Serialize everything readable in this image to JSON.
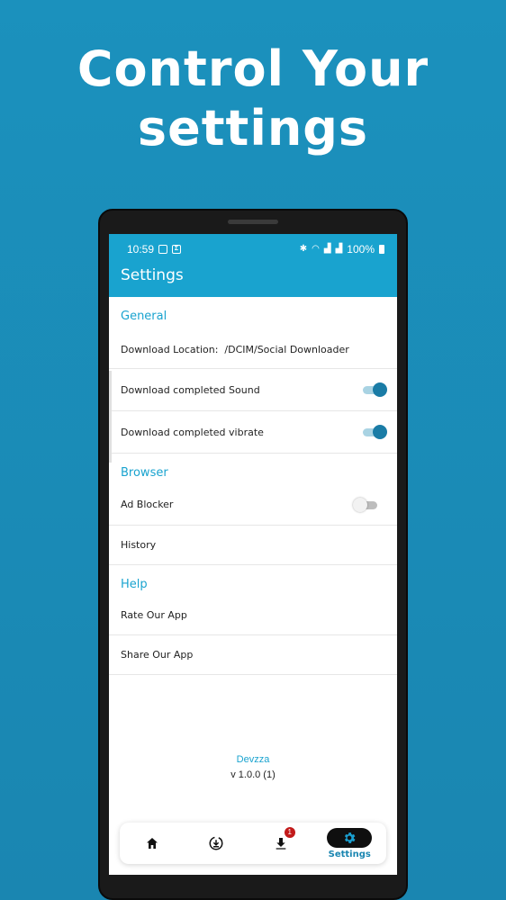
{
  "headline": {
    "line1": "Control Your",
    "line2": "settings"
  },
  "status_bar": {
    "time": "10:59",
    "battery": "100%"
  },
  "app_bar": {
    "title": "Settings"
  },
  "sections": {
    "general": {
      "title": "General",
      "download_location": {
        "label": "Download Location:",
        "value": "/DCIM/Social Downloader"
      },
      "sound": {
        "label": "Download completed Sound",
        "enabled": true
      },
      "vibrate": {
        "label": "Download completed vibrate",
        "enabled": true
      }
    },
    "browser": {
      "title": "Browser",
      "ad_blocker": {
        "label": "Ad Blocker",
        "enabled": false
      },
      "history": {
        "label": "History"
      }
    },
    "help": {
      "title": "Help",
      "rate": {
        "label": "Rate Our App"
      },
      "share": {
        "label": "Share Our App"
      }
    }
  },
  "footer": {
    "brand": "Devzza",
    "version": "v 1.0.0 (1)"
  },
  "bottom_nav": {
    "items": [
      {
        "icon": "home-icon"
      },
      {
        "icon": "download-circle-icon"
      },
      {
        "icon": "download-icon",
        "badge": "1"
      },
      {
        "icon": "gear-icon",
        "label": "Settings",
        "active": true
      }
    ]
  },
  "colors": {
    "background": "#1a8cb8",
    "app_bar": "#19a3cf",
    "accent": "#19a3cf",
    "toggle_on": "#1a7ca6",
    "badge": "#c21a1a",
    "active_label": "#1a86b1"
  }
}
